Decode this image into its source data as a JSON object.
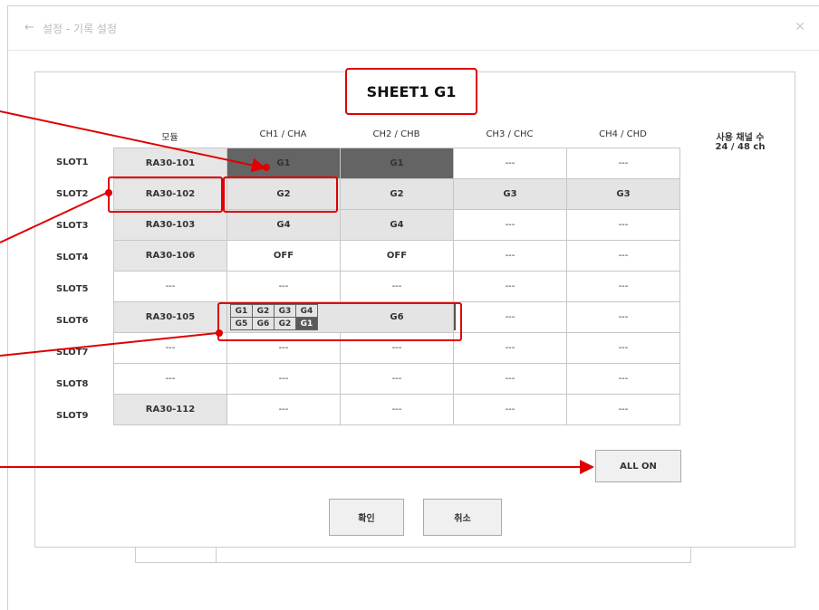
{
  "window": {
    "title": "설정 - 기록 설정",
    "back_icon": "arrow-left-icon",
    "close_icon": "close-icon"
  },
  "sheet": {
    "title": "SHEET1  G1"
  },
  "columns": {
    "module": "모듈",
    "ch1": "CH1 / CHA",
    "ch2": "CH2 / CHB",
    "ch3": "CH3 / CHC",
    "ch4": "CH4 / CHD"
  },
  "usage": {
    "label": "사용 채널 수",
    "value": "24 / 48 ch"
  },
  "slots": [
    {
      "label": "SLOT1",
      "module": "RA30-101",
      "ch1": "G1",
      "ch2": "G1",
      "ch3": "---",
      "ch4": "---"
    },
    {
      "label": "SLOT2",
      "module": "RA30-102",
      "ch1": "G2",
      "ch2": "G2",
      "ch3": "G3",
      "ch4": "G3"
    },
    {
      "label": "SLOT3",
      "module": "RA30-103",
      "ch1": "G4",
      "ch2": "G4",
      "ch3": "---",
      "ch4": "---"
    },
    {
      "label": "SLOT4",
      "module": "RA30-106",
      "ch1": "OFF",
      "ch2": "OFF",
      "ch3": "---",
      "ch4": "---"
    },
    {
      "label": "SLOT5",
      "module": "---",
      "ch1": "---",
      "ch2": "---",
      "ch3": "---",
      "ch4": "---"
    },
    {
      "label": "SLOT6",
      "module": "RA30-105",
      "ch1_groups": [
        "G1",
        "G2",
        "G3",
        "G4",
        "G5",
        "G6",
        "G2",
        "G1"
      ],
      "ch2": "G6",
      "ch3": "---",
      "ch4": "---"
    },
    {
      "label": "SLOT7",
      "module": "---",
      "ch1": "---",
      "ch2": "---",
      "ch3": "---",
      "ch4": "---"
    },
    {
      "label": "SLOT8",
      "module": "---",
      "ch1": "---",
      "ch2": "---",
      "ch3": "---",
      "ch4": "---"
    },
    {
      "label": "SLOT9",
      "module": "RA30-112",
      "ch1": "---",
      "ch2": "---",
      "ch3": "---",
      "ch4": "---"
    }
  ],
  "buttons": {
    "all_on": "ALL ON",
    "confirm": "확인",
    "cancel": "취소"
  },
  "colors": {
    "annotation": "#e00000",
    "selected_cell": "#646464",
    "group_cell": "#e4e4e4"
  }
}
